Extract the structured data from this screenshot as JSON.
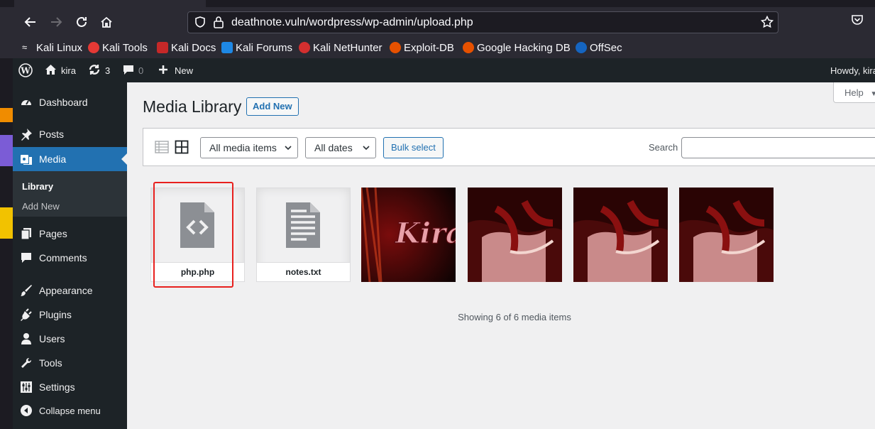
{
  "browser": {
    "url": "deathnote.vuln/wordpress/wp-admin/upload.php",
    "bookmarks": [
      {
        "label": "Kali Linux",
        "icon": "kali-dragon-icon",
        "color": "#ffffff"
      },
      {
        "label": "Kali Tools",
        "icon": "kali-tools-icon",
        "color": "#e53935"
      },
      {
        "label": "Kali Docs",
        "icon": "kali-docs-icon",
        "color": "#c62828"
      },
      {
        "label": "Kali Forums",
        "icon": "kali-forums-icon",
        "color": "#1e88e5"
      },
      {
        "label": "Kali NetHunter",
        "icon": "nethunter-icon",
        "color": "#d32f2f"
      },
      {
        "label": "Exploit-DB",
        "icon": "exploit-db-icon",
        "color": "#e65100"
      },
      {
        "label": "Google Hacking DB",
        "icon": "ghdb-icon",
        "color": "#e65100"
      },
      {
        "label": "OffSec",
        "icon": "offsec-icon",
        "color": "#1565c0"
      }
    ]
  },
  "adminbar": {
    "site_name": "kira",
    "updates_count": "3",
    "comments_count": "0",
    "new_label": "New",
    "howdy": "Howdy, kira"
  },
  "sidebar": {
    "items": [
      {
        "label": "Dashboard",
        "icon": "dashboard-icon"
      },
      {
        "label": "Posts",
        "icon": "pin-icon"
      },
      {
        "label": "Media",
        "icon": "media-icon",
        "active": true
      },
      {
        "label": "Pages",
        "icon": "pages-icon"
      },
      {
        "label": "Comments",
        "icon": "comment-icon"
      },
      {
        "label": "Appearance",
        "icon": "brush-icon"
      },
      {
        "label": "Plugins",
        "icon": "plug-icon"
      },
      {
        "label": "Users",
        "icon": "user-icon"
      },
      {
        "label": "Tools",
        "icon": "wrench-icon"
      },
      {
        "label": "Settings",
        "icon": "settings-icon"
      },
      {
        "label": "Collapse menu",
        "icon": "collapse-icon"
      }
    ],
    "submenu": [
      "Library",
      "Add New"
    ]
  },
  "main": {
    "help_label": "Help",
    "title": "Media Library",
    "add_new_label": "Add New",
    "filter_type": "All media items",
    "filter_date": "All dates",
    "bulk_select_label": "Bulk select",
    "search_label": "Search",
    "files": [
      {
        "name": "php.php",
        "icon": "code-file-icon"
      },
      {
        "name": "notes.txt",
        "icon": "text-file-icon"
      }
    ],
    "image_overlay_text": "Kira",
    "showing_text": "Showing 6 of 6 media items"
  },
  "colors": {
    "accent": "#2271b1",
    "admin_dark": "#1d2327",
    "highlight": "#e8201e"
  }
}
